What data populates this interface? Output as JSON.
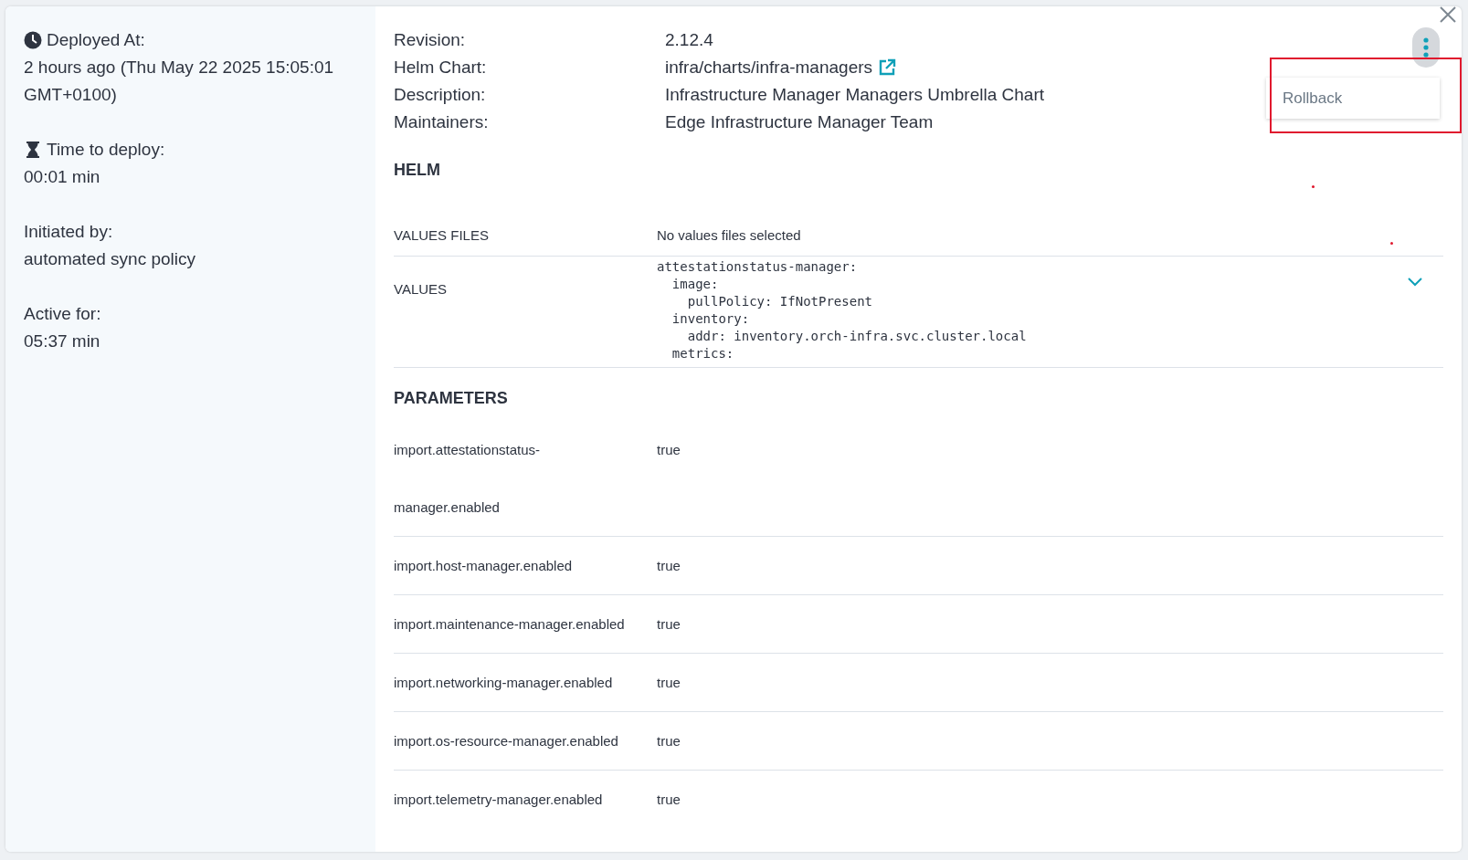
{
  "summary": [
    {
      "kind": "timestamp",
      "label": "Deployed At:",
      "value": "2 hours ago (Thu May 22 2025 15:05:01 GMT+0100)"
    },
    {
      "kind": "duration",
      "label": "Time to deploy:",
      "value": "00:01 min"
    },
    {
      "kind": "plain",
      "label": "Initiated by:",
      "value": "automated sync policy"
    },
    {
      "kind": "plain",
      "label": "Active for:",
      "value": "05:37 min"
    }
  ],
  "info": [
    {
      "label": "Revision:",
      "value": "2.12.4",
      "kind": "text"
    },
    {
      "label": "Helm Chart:",
      "value": "infra/charts/infra-managers",
      "kind": "link"
    },
    {
      "label": "Description:",
      "value": "Infrastructure Manager Managers Umbrella Chart",
      "kind": "text"
    },
    {
      "label": "Maintainers:",
      "value": "Edge Infrastructure Manager Team",
      "kind": "text"
    }
  ],
  "helm": {
    "title": "HELM",
    "values_files_label": "VALUES FILES",
    "values_files": "No values files selected",
    "values_label": "VALUES",
    "values_lines": [
      "attestationstatus-manager:",
      "  image:",
      "    pullPolicy: IfNotPresent",
      "  inventory:",
      "    addr: inventory.orch-infra.svc.cluster.local",
      "  metrics:"
    ],
    "expanded": false
  },
  "parameters": {
    "title": "PARAMETERS",
    "rows": [
      {
        "name": "import.attestationstatus-manager.enabled",
        "value": "true"
      },
      {
        "name": "import.host-manager.enabled",
        "value": "true"
      },
      {
        "name": "import.maintenance-manager.enabled",
        "value": "true"
      },
      {
        "name": "import.networking-manager.enabled",
        "value": "true"
      },
      {
        "name": "import.os-resource-manager.enabled",
        "value": "true"
      },
      {
        "name": "import.telemetry-manager.enabled",
        "value": "true"
      }
    ]
  },
  "menu": {
    "items": [
      "Rollback"
    ],
    "highlighted": true
  }
}
